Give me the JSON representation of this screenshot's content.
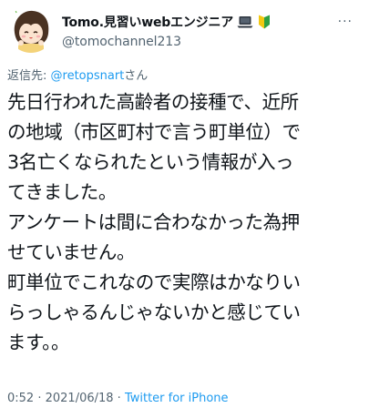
{
  "author": {
    "display_name": "Tomo.見習いwebエンジニア",
    "handle": "@tomochannel213",
    "badge_icons": [
      "laptop-icon",
      "beginner-leaf-icon"
    ]
  },
  "menu": {
    "more_label": "···"
  },
  "reply_context": {
    "prefix": "返信先: ",
    "mention": "@retopsnart",
    "suffix": "さん"
  },
  "body": {
    "lines": [
      "先日行われた高齢者の接種で、近所",
      "の地域（市区町村で言う町単位）で",
      "3名亡くなられたという情報が入っ",
      "てきました。",
      "アンケートは間に合わなかった為押",
      "せていません。",
      "町単位でこれなので実際はかなりい",
      "らっしゃるんじゃないかと感じてい",
      "ます。。"
    ]
  },
  "meta": {
    "time": "0:52",
    "separator": " · ",
    "date": "2021/06/18",
    "source": "Twitter for iPhone"
  },
  "colors": {
    "text": "#0f1419",
    "secondary": "#536471",
    "link": "#1d9bf0"
  }
}
